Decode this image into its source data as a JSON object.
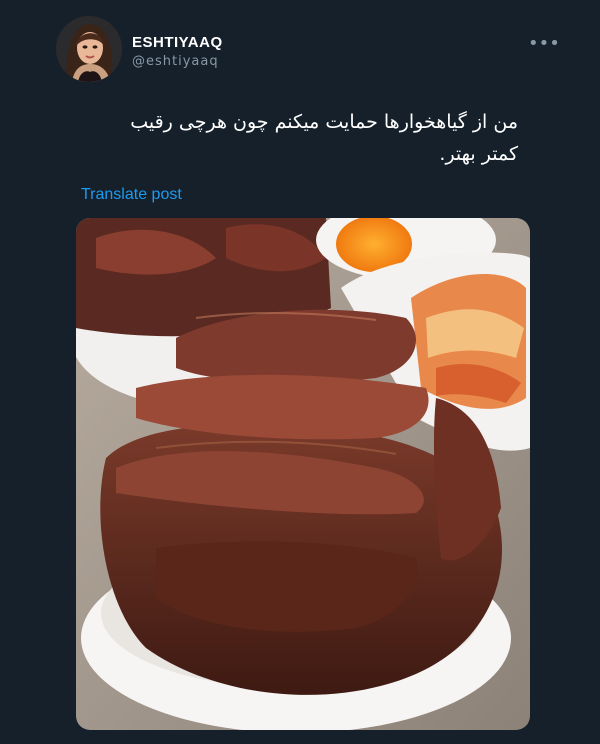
{
  "tweet": {
    "display_name": "ESHTIYAAQ",
    "handle": "@eshtiyaaq",
    "text": "من از گیاهخوارها حمایت میکنم چون هرچی رقیب\nکمتر بهتر.",
    "translate_label": "Translate post",
    "more_icon": "more-options-icon",
    "media_alt_icon": "food-photo"
  },
  "colors": {
    "background": "#15202b",
    "link": "#1d9bf0",
    "secondary_text": "#8899a6"
  }
}
